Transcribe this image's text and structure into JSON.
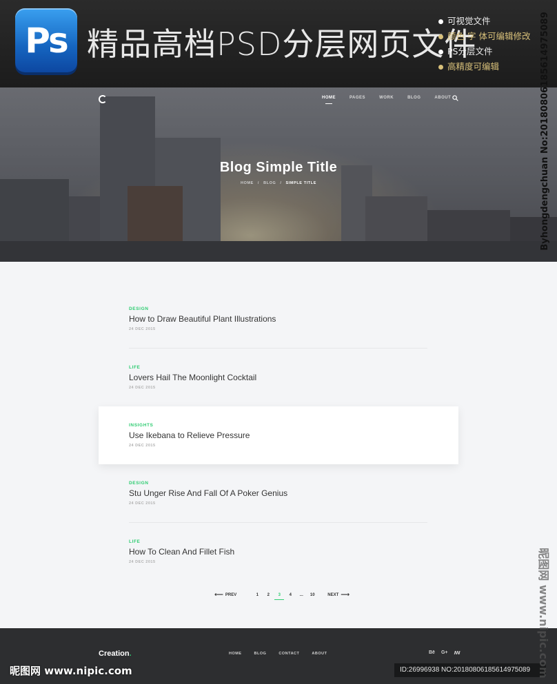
{
  "banner": {
    "logo": "Ps",
    "title": "精品高档PSD分层网页文件",
    "features": [
      "可视觉文件",
      "颜色 字 体可编辑修改",
      "PS分层文件",
      "高精度可编辑"
    ],
    "vertical_credit": "Byhongdengchuan No:20180806185614975089"
  },
  "nav": {
    "items": [
      "HOME",
      "PAGES",
      "WORK",
      "BLOG",
      "ABOUT"
    ],
    "active": "HOME"
  },
  "hero": {
    "title": "Blog Simple Title",
    "breadcrumb": [
      "HOME",
      "BLOG",
      "SIMPLE TITLE"
    ],
    "separator": "/"
  },
  "posts": [
    {
      "category": "DESIGN",
      "title": "How to Draw Beautiful Plant Illustrations",
      "date": "24 DEC 2015"
    },
    {
      "category": "LIFE",
      "title": "Lovers Hail The Moonlight Cocktail",
      "date": "24 DEC 2015"
    },
    {
      "category": "INSIGHTS",
      "title": "Use Ikebana to Relieve Pressure",
      "date": "24 DEC 2015"
    },
    {
      "category": "DESIGN",
      "title": "Stu Unger Rise And Fall Of A Poker Genius",
      "date": "24 DEC 2015"
    },
    {
      "category": "LIFE",
      "title": "How To Clean And Fillet Fish",
      "date": "24 DEC 2015"
    }
  ],
  "pagination": {
    "prev": "PREV",
    "next": "NEXT",
    "pages": [
      "1",
      "2",
      "3",
      "4",
      "...",
      "10"
    ],
    "active": "3"
  },
  "footer": {
    "brand": "Creation",
    "brand_dot": ".",
    "nav": [
      "HOME",
      "BLOG",
      "CONTACT",
      "ABOUT"
    ],
    "social": [
      "Bē",
      "G+",
      "ꟿ"
    ]
  },
  "watermarks": {
    "bottom_left": "昵图网 www.nipic.com",
    "bottom_right": "ID:26996938 NO:20180806185614975089",
    "right_vertical": "昵图网 www.nipic.com"
  },
  "colors": {
    "accent": "#2ecc71",
    "footer_bg": "#2d2e30",
    "page_bg": "#f4f5f7"
  }
}
